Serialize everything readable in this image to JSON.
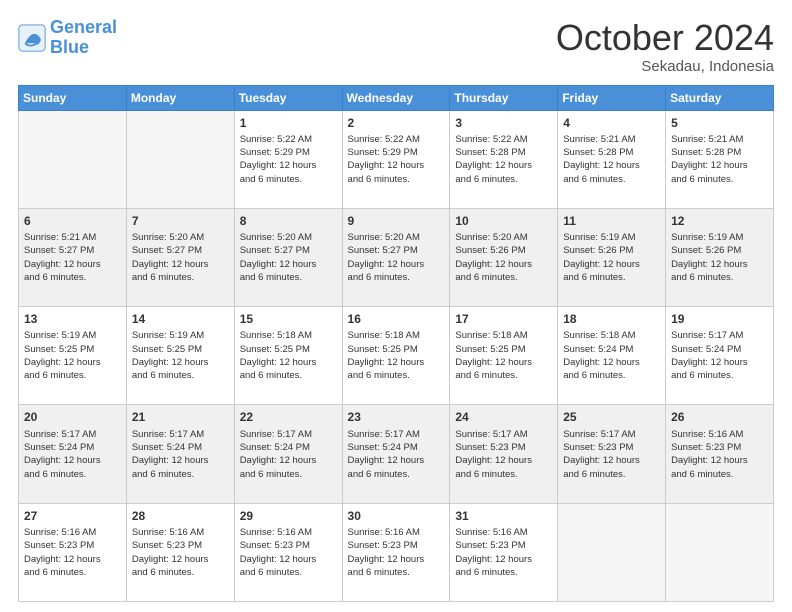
{
  "logo": {
    "line1": "General",
    "line2": "Blue"
  },
  "header": {
    "month": "October 2024",
    "location": "Sekadau, Indonesia"
  },
  "days_of_week": [
    "Sunday",
    "Monday",
    "Tuesday",
    "Wednesday",
    "Thursday",
    "Friday",
    "Saturday"
  ],
  "weeks": [
    [
      {
        "day": "",
        "info": ""
      },
      {
        "day": "",
        "info": ""
      },
      {
        "day": "1",
        "info": "Sunrise: 5:22 AM\nSunset: 5:29 PM\nDaylight: 12 hours\nand 6 minutes."
      },
      {
        "day": "2",
        "info": "Sunrise: 5:22 AM\nSunset: 5:29 PM\nDaylight: 12 hours\nand 6 minutes."
      },
      {
        "day": "3",
        "info": "Sunrise: 5:22 AM\nSunset: 5:28 PM\nDaylight: 12 hours\nand 6 minutes."
      },
      {
        "day": "4",
        "info": "Sunrise: 5:21 AM\nSunset: 5:28 PM\nDaylight: 12 hours\nand 6 minutes."
      },
      {
        "day": "5",
        "info": "Sunrise: 5:21 AM\nSunset: 5:28 PM\nDaylight: 12 hours\nand 6 minutes."
      }
    ],
    [
      {
        "day": "6",
        "info": "Sunrise: 5:21 AM\nSunset: 5:27 PM\nDaylight: 12 hours\nand 6 minutes."
      },
      {
        "day": "7",
        "info": "Sunrise: 5:20 AM\nSunset: 5:27 PM\nDaylight: 12 hours\nand 6 minutes."
      },
      {
        "day": "8",
        "info": "Sunrise: 5:20 AM\nSunset: 5:27 PM\nDaylight: 12 hours\nand 6 minutes."
      },
      {
        "day": "9",
        "info": "Sunrise: 5:20 AM\nSunset: 5:27 PM\nDaylight: 12 hours\nand 6 minutes."
      },
      {
        "day": "10",
        "info": "Sunrise: 5:20 AM\nSunset: 5:26 PM\nDaylight: 12 hours\nand 6 minutes."
      },
      {
        "day": "11",
        "info": "Sunrise: 5:19 AM\nSunset: 5:26 PM\nDaylight: 12 hours\nand 6 minutes."
      },
      {
        "day": "12",
        "info": "Sunrise: 5:19 AM\nSunset: 5:26 PM\nDaylight: 12 hours\nand 6 minutes."
      }
    ],
    [
      {
        "day": "13",
        "info": "Sunrise: 5:19 AM\nSunset: 5:25 PM\nDaylight: 12 hours\nand 6 minutes."
      },
      {
        "day": "14",
        "info": "Sunrise: 5:19 AM\nSunset: 5:25 PM\nDaylight: 12 hours\nand 6 minutes."
      },
      {
        "day": "15",
        "info": "Sunrise: 5:18 AM\nSunset: 5:25 PM\nDaylight: 12 hours\nand 6 minutes."
      },
      {
        "day": "16",
        "info": "Sunrise: 5:18 AM\nSunset: 5:25 PM\nDaylight: 12 hours\nand 6 minutes."
      },
      {
        "day": "17",
        "info": "Sunrise: 5:18 AM\nSunset: 5:25 PM\nDaylight: 12 hours\nand 6 minutes."
      },
      {
        "day": "18",
        "info": "Sunrise: 5:18 AM\nSunset: 5:24 PM\nDaylight: 12 hours\nand 6 minutes."
      },
      {
        "day": "19",
        "info": "Sunrise: 5:17 AM\nSunset: 5:24 PM\nDaylight: 12 hours\nand 6 minutes."
      }
    ],
    [
      {
        "day": "20",
        "info": "Sunrise: 5:17 AM\nSunset: 5:24 PM\nDaylight: 12 hours\nand 6 minutes."
      },
      {
        "day": "21",
        "info": "Sunrise: 5:17 AM\nSunset: 5:24 PM\nDaylight: 12 hours\nand 6 minutes."
      },
      {
        "day": "22",
        "info": "Sunrise: 5:17 AM\nSunset: 5:24 PM\nDaylight: 12 hours\nand 6 minutes."
      },
      {
        "day": "23",
        "info": "Sunrise: 5:17 AM\nSunset: 5:24 PM\nDaylight: 12 hours\nand 6 minutes."
      },
      {
        "day": "24",
        "info": "Sunrise: 5:17 AM\nSunset: 5:23 PM\nDaylight: 12 hours\nand 6 minutes."
      },
      {
        "day": "25",
        "info": "Sunrise: 5:17 AM\nSunset: 5:23 PM\nDaylight: 12 hours\nand 6 minutes."
      },
      {
        "day": "26",
        "info": "Sunrise: 5:16 AM\nSunset: 5:23 PM\nDaylight: 12 hours\nand 6 minutes."
      }
    ],
    [
      {
        "day": "27",
        "info": "Sunrise: 5:16 AM\nSunset: 5:23 PM\nDaylight: 12 hours\nand 6 minutes."
      },
      {
        "day": "28",
        "info": "Sunrise: 5:16 AM\nSunset: 5:23 PM\nDaylight: 12 hours\nand 6 minutes."
      },
      {
        "day": "29",
        "info": "Sunrise: 5:16 AM\nSunset: 5:23 PM\nDaylight: 12 hours\nand 6 minutes."
      },
      {
        "day": "30",
        "info": "Sunrise: 5:16 AM\nSunset: 5:23 PM\nDaylight: 12 hours\nand 6 minutes."
      },
      {
        "day": "31",
        "info": "Sunrise: 5:16 AM\nSunset: 5:23 PM\nDaylight: 12 hours\nand 6 minutes."
      },
      {
        "day": "",
        "info": ""
      },
      {
        "day": "",
        "info": ""
      }
    ]
  ]
}
